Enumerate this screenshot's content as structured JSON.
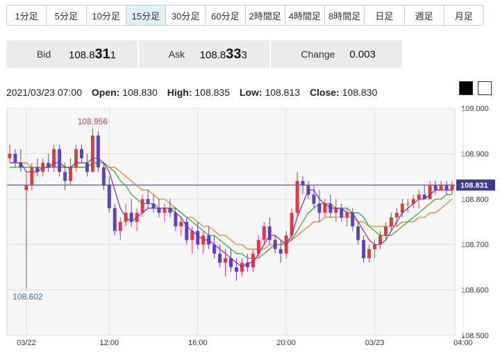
{
  "tabs": [
    "1分足",
    "5分足",
    "10分足",
    "15分足",
    "30分足",
    "60分足",
    "2時間足",
    "4時間足",
    "8時間足",
    "日足",
    "週足",
    "月足"
  ],
  "active_tab": "15分足",
  "quote": {
    "bid_label": "Bid",
    "bid_main": "108.8",
    "bid_big": "31",
    "bid_tail": "1",
    "ask_label": "Ask",
    "ask_main": "108.8",
    "ask_big": "33",
    "ask_tail": "3",
    "change_label": "Change",
    "change_value": "0.003"
  },
  "info": {
    "datetime": "2021/03/23 07:00",
    "open_label": "Open:",
    "open": "108.830",
    "high_label": "High:",
    "high": "108.835",
    "low_label": "Low:",
    "low": "108.813",
    "close_label": "Close:",
    "close": "108.830"
  },
  "colors": {
    "up": "#e8383d",
    "down": "#5a3fd1",
    "ma_short": "#8e24aa",
    "ma_mid": "#1fb31f",
    "ma_long": "#ee7d22",
    "current_line": "#3b3b8f",
    "high_label": "#d63a4a",
    "low_label": "#3a6fc4"
  },
  "chart_data": {
    "type": "candlestick",
    "ylim": [
      108.5,
      109.0
    ],
    "y_ticks": [
      "109.000",
      "108.900",
      "108.800",
      "108.700",
      "108.600",
      "108.500"
    ],
    "y_tick_values": [
      109.0,
      108.9,
      108.8,
      108.7,
      108.6,
      108.5
    ],
    "x_tick_labels": [
      "03/22",
      "12:00",
      "16:00",
      "20:00",
      "03/23",
      "04:00"
    ],
    "x_tick_index": [
      3,
      18,
      34,
      50,
      66,
      82
    ],
    "current_price_label": "108.831",
    "current_price": 108.831,
    "high_marker": {
      "label": "108.956",
      "index": 15,
      "value": 108.956
    },
    "low_marker": {
      "label": "108.602",
      "index": 3,
      "value": 108.602
    },
    "candles": [
      [
        108.89,
        108.92,
        108.88,
        108.9
      ],
      [
        108.9,
        108.91,
        108.87,
        108.88
      ],
      [
        108.88,
        108.91,
        108.86,
        108.87
      ],
      [
        108.82,
        108.86,
        108.602,
        108.83
      ],
      [
        108.83,
        108.88,
        108.82,
        108.87
      ],
      [
        108.87,
        108.89,
        108.85,
        108.86
      ],
      [
        108.86,
        108.89,
        108.85,
        108.88
      ],
      [
        108.88,
        108.9,
        108.86,
        108.87
      ],
      [
        108.87,
        108.92,
        108.86,
        108.91
      ],
      [
        108.91,
        108.92,
        108.85,
        108.86
      ],
      [
        108.86,
        108.88,
        108.82,
        108.84
      ],
      [
        108.84,
        108.89,
        108.83,
        108.87
      ],
      [
        108.87,
        108.92,
        108.86,
        108.91
      ],
      [
        108.91,
        108.92,
        108.88,
        108.89
      ],
      [
        108.88,
        108.9,
        108.85,
        108.86
      ],
      [
        108.86,
        108.956,
        108.86,
        108.94
      ],
      [
        108.94,
        108.95,
        108.86,
        108.87
      ],
      [
        108.87,
        108.88,
        108.82,
        108.83
      ],
      [
        108.83,
        108.85,
        108.77,
        108.78
      ],
      [
        108.78,
        108.79,
        108.72,
        108.73
      ],
      [
        108.73,
        108.76,
        108.71,
        108.75
      ],
      [
        108.75,
        108.79,
        108.74,
        108.77
      ],
      [
        108.77,
        108.8,
        108.74,
        108.75
      ],
      [
        108.75,
        108.78,
        108.73,
        108.77
      ],
      [
        108.77,
        108.81,
        108.76,
        108.8
      ],
      [
        108.8,
        108.82,
        108.78,
        108.79
      ],
      [
        108.79,
        108.81,
        108.77,
        108.78
      ],
      [
        108.78,
        108.8,
        108.76,
        108.77
      ],
      [
        108.77,
        108.79,
        108.75,
        108.78
      ],
      [
        108.78,
        108.8,
        108.76,
        108.77
      ],
      [
        108.77,
        108.78,
        108.73,
        108.74
      ],
      [
        108.74,
        108.76,
        108.72,
        108.75
      ],
      [
        108.75,
        108.76,
        108.7,
        108.71
      ],
      [
        108.71,
        108.74,
        108.68,
        108.73
      ],
      [
        108.73,
        108.75,
        108.69,
        108.7
      ],
      [
        108.7,
        108.73,
        108.68,
        108.72
      ],
      [
        108.72,
        108.74,
        108.69,
        108.7
      ],
      [
        108.7,
        108.72,
        108.67,
        108.68
      ],
      [
        108.68,
        108.7,
        108.65,
        108.66
      ],
      [
        108.66,
        108.69,
        108.63,
        108.67
      ],
      [
        108.67,
        108.69,
        108.64,
        108.65
      ],
      [
        108.65,
        108.67,
        108.62,
        108.64
      ],
      [
        108.64,
        108.67,
        108.63,
        108.66
      ],
      [
        108.66,
        108.68,
        108.64,
        108.65
      ],
      [
        108.65,
        108.69,
        108.64,
        108.68
      ],
      [
        108.68,
        108.72,
        108.67,
        108.71
      ],
      [
        108.71,
        108.75,
        108.7,
        108.74
      ],
      [
        108.74,
        108.76,
        108.7,
        108.71
      ],
      [
        108.71,
        108.72,
        108.68,
        108.69
      ],
      [
        108.69,
        108.71,
        108.66,
        108.68
      ],
      [
        108.68,
        108.73,
        108.67,
        108.72
      ],
      [
        108.72,
        108.78,
        108.71,
        108.77
      ],
      [
        108.77,
        108.86,
        108.76,
        108.84
      ],
      [
        108.84,
        108.85,
        108.81,
        108.83
      ],
      [
        108.83,
        108.84,
        108.8,
        108.81
      ],
      [
        108.81,
        108.83,
        108.78,
        108.79
      ],
      [
        108.79,
        108.82,
        108.75,
        108.77
      ],
      [
        108.77,
        108.8,
        108.76,
        108.79
      ],
      [
        108.79,
        108.81,
        108.76,
        108.77
      ],
      [
        108.77,
        108.8,
        108.75,
        108.78
      ],
      [
        108.78,
        108.79,
        108.75,
        108.76
      ],
      [
        108.76,
        108.78,
        108.74,
        108.77
      ],
      [
        108.77,
        108.78,
        108.73,
        108.74
      ],
      [
        108.74,
        108.75,
        108.7,
        108.71
      ],
      [
        108.71,
        108.72,
        108.66,
        108.67
      ],
      [
        108.67,
        108.7,
        108.66,
        108.69
      ],
      [
        108.69,
        108.71,
        108.67,
        108.7
      ],
      [
        108.7,
        108.73,
        108.69,
        108.72
      ],
      [
        108.72,
        108.75,
        108.71,
        108.74
      ],
      [
        108.74,
        108.77,
        108.73,
        108.76
      ],
      [
        108.76,
        108.78,
        108.74,
        108.77
      ],
      [
        108.77,
        108.8,
        108.76,
        108.79
      ],
      [
        108.79,
        108.8,
        108.77,
        108.79
      ],
      [
        108.79,
        108.81,
        108.78,
        108.8
      ],
      [
        108.8,
        108.82,
        108.78,
        108.81
      ],
      [
        108.81,
        108.83,
        108.8,
        108.8
      ],
      [
        108.8,
        108.84,
        108.8,
        108.83
      ],
      [
        108.83,
        108.84,
        108.81,
        108.82
      ],
      [
        108.82,
        108.84,
        108.82,
        108.83
      ],
      [
        108.83,
        108.84,
        108.81,
        108.82
      ],
      [
        108.82,
        108.84,
        108.81,
        108.83
      ]
    ],
    "ma_short": [
      108.88,
      108.88,
      108.88,
      108.86,
      108.86,
      108.86,
      108.87,
      108.87,
      108.88,
      108.88,
      108.87,
      108.87,
      108.88,
      108.88,
      108.88,
      108.89,
      108.89,
      108.88,
      108.86,
      108.82,
      108.78,
      108.76,
      108.75,
      108.76,
      108.77,
      108.78,
      108.78,
      108.78,
      108.78,
      108.78,
      108.77,
      108.76,
      108.74,
      108.73,
      108.72,
      108.71,
      108.71,
      108.7,
      108.69,
      108.68,
      108.67,
      108.66,
      108.65,
      108.66,
      108.66,
      108.68,
      108.7,
      108.72,
      108.72,
      108.71,
      108.7,
      108.72,
      108.76,
      108.79,
      108.82,
      108.82,
      108.8,
      108.79,
      108.78,
      108.78,
      108.78,
      108.77,
      108.77,
      108.75,
      108.73,
      108.71,
      108.7,
      108.7,
      108.71,
      108.73,
      108.75,
      108.77,
      108.78,
      108.79,
      108.8,
      108.8,
      108.81,
      108.82,
      108.82,
      108.82,
      108.82
    ],
    "ma_mid": [
      108.87,
      108.87,
      108.87,
      108.87,
      108.87,
      108.87,
      108.87,
      108.87,
      108.87,
      108.87,
      108.87,
      108.87,
      108.87,
      108.87,
      108.87,
      108.88,
      108.88,
      108.88,
      108.87,
      108.86,
      108.84,
      108.83,
      108.81,
      108.8,
      108.79,
      108.79,
      108.79,
      108.78,
      108.78,
      108.78,
      108.78,
      108.77,
      108.76,
      108.75,
      108.74,
      108.73,
      108.72,
      108.72,
      108.71,
      108.7,
      108.69,
      108.68,
      108.68,
      108.67,
      108.67,
      108.67,
      108.68,
      108.69,
      108.7,
      108.7,
      108.7,
      108.71,
      108.73,
      108.75,
      108.77,
      108.78,
      108.79,
      108.79,
      108.79,
      108.78,
      108.78,
      108.78,
      108.77,
      108.77,
      108.76,
      108.74,
      108.73,
      108.72,
      108.72,
      108.72,
      108.73,
      108.74,
      108.75,
      108.76,
      108.77,
      108.78,
      108.79,
      108.8,
      108.8,
      108.81,
      108.81
    ],
    "ma_long": [
      108.88,
      108.88,
      108.88,
      108.88,
      108.87,
      108.87,
      108.87,
      108.87,
      108.87,
      108.87,
      108.87,
      108.87,
      108.87,
      108.87,
      108.87,
      108.88,
      108.88,
      108.88,
      108.87,
      108.87,
      108.86,
      108.85,
      108.84,
      108.83,
      108.82,
      108.82,
      108.81,
      108.8,
      108.8,
      108.79,
      108.78,
      108.77,
      108.76,
      108.76,
      108.75,
      108.74,
      108.74,
      108.73,
      108.72,
      108.72,
      108.71,
      108.7,
      108.7,
      108.69,
      108.69,
      108.69,
      108.69,
      108.7,
      108.7,
      108.7,
      108.71,
      108.71,
      108.72,
      108.73,
      108.74,
      108.75,
      108.75,
      108.76,
      108.76,
      108.76,
      108.76,
      108.76,
      108.76,
      108.75,
      108.75,
      108.74,
      108.74,
      108.74,
      108.74,
      108.74,
      108.74,
      108.75,
      108.75,
      108.75,
      108.76,
      108.76,
      108.77,
      108.77,
      108.78,
      108.79,
      108.8
    ]
  }
}
